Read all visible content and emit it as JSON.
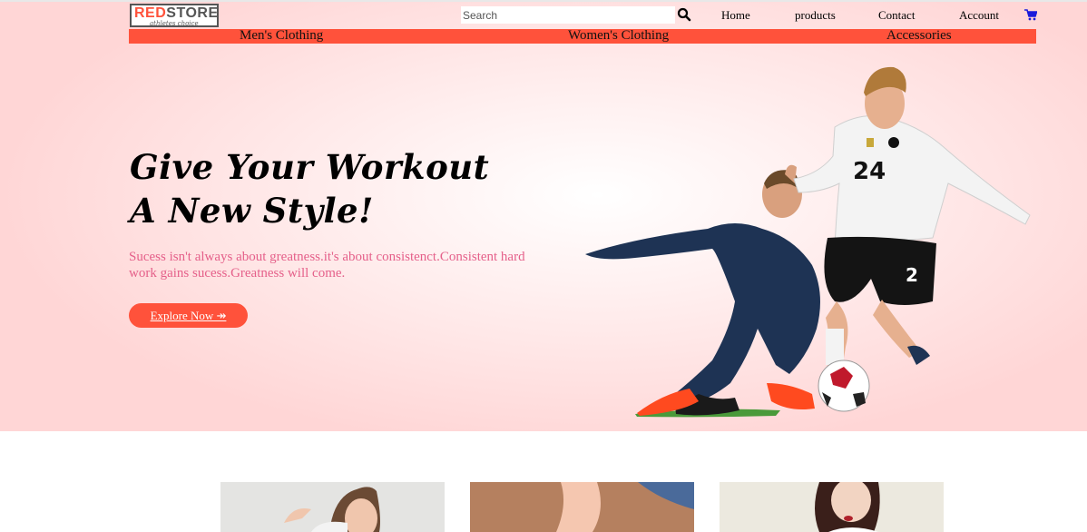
{
  "logo": {
    "brand_red": "RED",
    "brand_dark": "STORE",
    "tagline": "athletes choice"
  },
  "search": {
    "placeholder": "Search"
  },
  "nav": {
    "home": "Home",
    "products": "products",
    "contact": "Contact",
    "account": "Account"
  },
  "categories": [
    "Men's Clothing",
    "Women's Clothing",
    "Accessories"
  ],
  "hero": {
    "headline_line1": "Give Your Workout",
    "headline_line2": "A New Style!",
    "tagline": "Sucess isn't always about greatness.it's about consistenct.Consistent hard work gains sucess.Greatness will come.",
    "cta_label": "Explore Now ↠"
  },
  "colors": {
    "accent": "#ff523b",
    "tagline_pink": "#e5608a",
    "hero_bg": "#ffd6d6",
    "cart_blue": "#1a1adb"
  }
}
